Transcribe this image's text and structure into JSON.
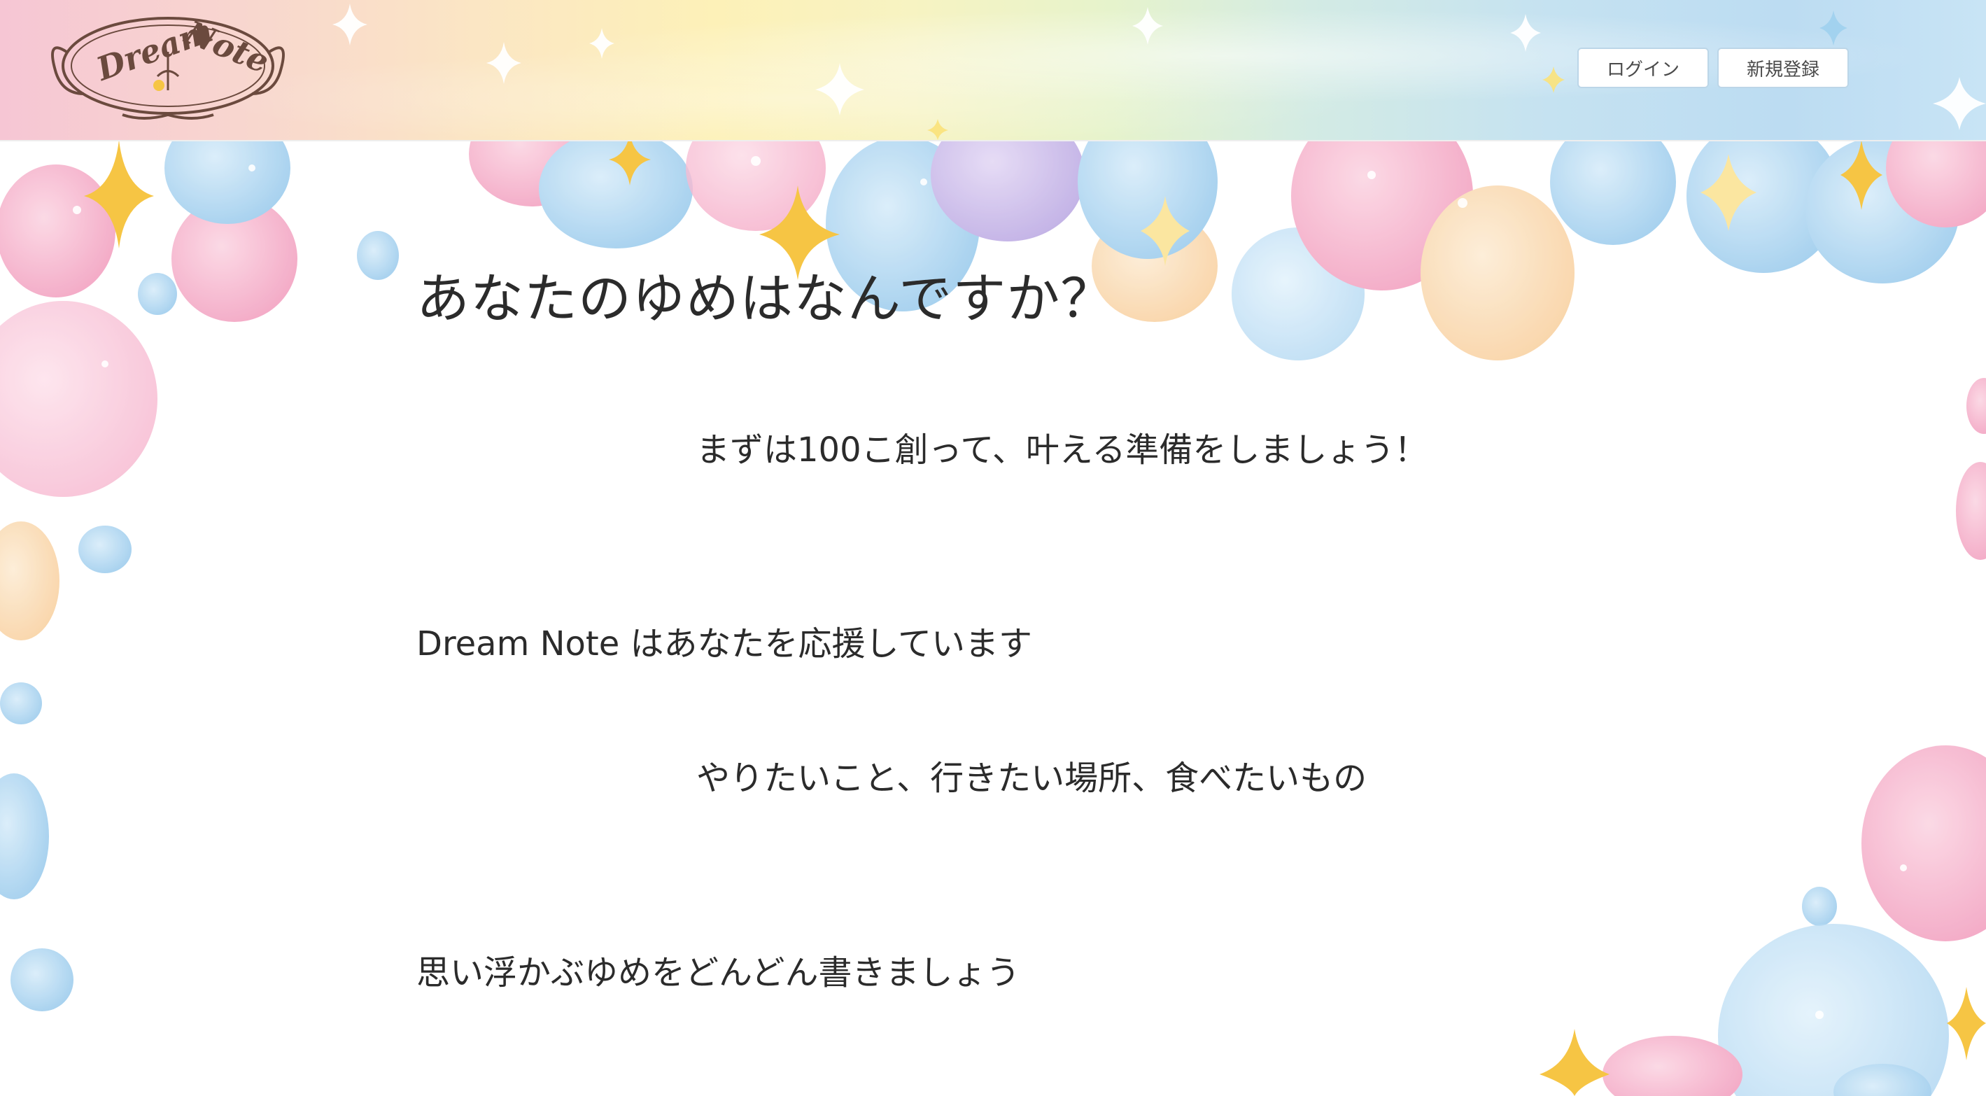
{
  "header": {
    "logo_text": [
      "Dream",
      "Note"
    ],
    "login_label": "ログイン",
    "signup_label": "新規登録"
  },
  "main": {
    "heading": "あなたのゆめはなんですか？",
    "line1": "まずは100こ創って、叶える準備をしましょう！",
    "line2": "Dream Note はあなたを応援しています",
    "line3": "やりたいこと、行きたい場所、食べたいもの",
    "line4": "思い浮かぶゆめをどんどん書きましょう"
  },
  "colors": {
    "pink": "#f4a9c3",
    "blue": "#a9d3ef",
    "lavender": "#c9b6e8",
    "peach": "#fbd9b0",
    "star": "#f6c544",
    "text": "#2b2b2b",
    "logo": "#6b4a3e"
  },
  "icons": [
    "logo-emblem-icon",
    "sparkle-icon",
    "watercolor-bubble"
  ]
}
